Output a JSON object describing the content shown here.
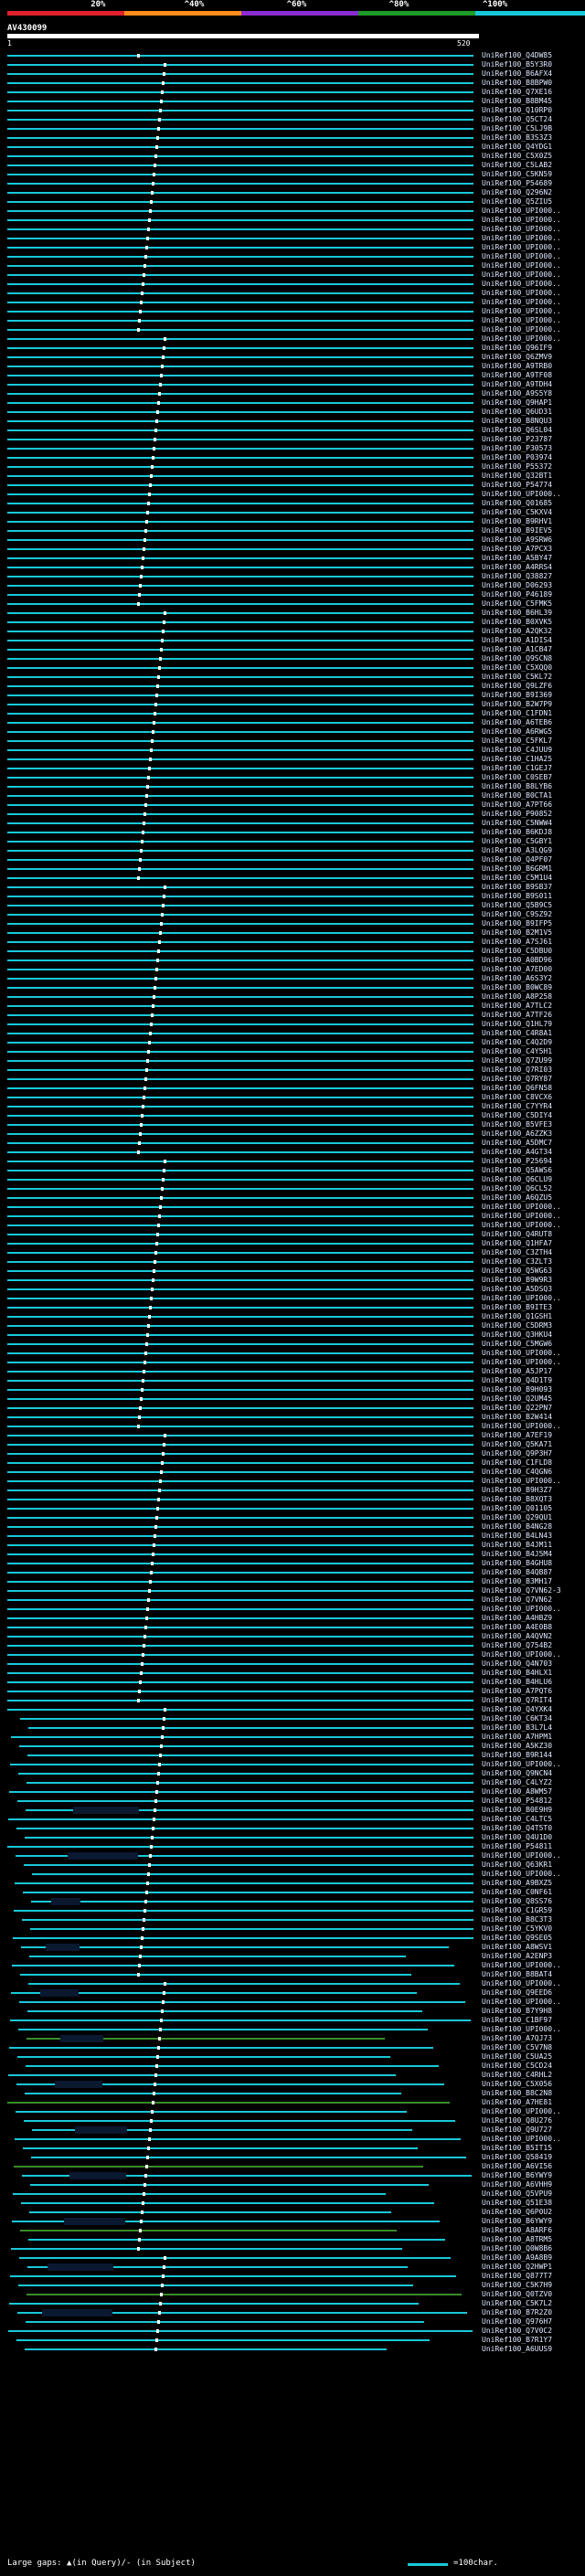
{
  "scale": {
    "labels": [
      "20%",
      "^40%",
      "^60%",
      "^80%",
      "^100%"
    ],
    "colors": [
      "#e0202a",
      "#ff8c1a",
      "#8a2ccf",
      "#1e9c2a",
      "#19c8d8"
    ]
  },
  "query": {
    "id": "AV430099",
    "start": "1",
    "end": "520"
  },
  "line_colors": {
    "default": "#19c8d8",
    "low": "#3a8c2a",
    "gap": "#0a1830"
  },
  "hits": [
    "UniRef100_Q4DW85",
    "UniRef100_B5Y3R0",
    "UniRef100_B6AFX4",
    "UniRef100_B8BPW0",
    "UniRef100_Q7XE16",
    "UniRef100_B8BM45",
    "UniRef100_Q10RP0",
    "UniRef100_Q5CT24",
    "UniRef100_C5LJ9B",
    "UniRef100_B3S3Z3",
    "UniRef100_Q4YDG1",
    "UniRef100_C5X0Z5",
    "UniRef100_C5LAB2",
    "UniRef100_C5KN59",
    "UniRef100_P54689",
    "UniRef100_Q296N2",
    "UniRef100_Q5ZIU5",
    "UniRef100_UPI000..",
    "UniRef100_UPI000..",
    "UniRef100_UPI000..",
    "UniRef100_UPI000..",
    "UniRef100_UPI000..",
    "UniRef100_UPI000..",
    "UniRef100_UPI000..",
    "UniRef100_UPI000..",
    "UniRef100_UPI000..",
    "UniRef100_UPI000..",
    "UniRef100_UPI000..",
    "UniRef100_UPI000..",
    "UniRef100_UPI000..",
    "UniRef100_UPI000..",
    "UniRef100_UPI000..",
    "UniRef100_Q96IF9",
    "UniRef100_Q6ZMV9",
    "UniRef100_A9TRB0",
    "UniRef100_A9TF08",
    "UniRef100_A9TDH4",
    "UniRef100_A9S5Y8",
    "UniRef100_Q9HAP1",
    "UniRef100_Q6UD31",
    "UniRef100_B8NQU3",
    "UniRef100_Q6SL04",
    "UniRef100_P23787",
    "UniRef100_P30573",
    "UniRef100_P03974",
    "UniRef100_P55372",
    "UniRef100_Q32BT1",
    "UniRef100_P54774",
    "UniRef100_UPI000..",
    "UniRef100_Q01685",
    "UniRef100_C5KXV4",
    "UniRef100_B9RHV1",
    "UniRef100_B9IEV5",
    "UniRef100_A9SRW6",
    "UniRef100_A7PCX3",
    "UniRef100_A5BY47",
    "UniRef100_A4RRS4",
    "UniRef100_Q38827",
    "UniRef100_D06293",
    "UniRef100_P46189",
    "UniRef100_C5FMK5",
    "UniRef100_B6HL39",
    "UniRef100_B0XVK5",
    "UniRef100_A2QK32",
    "UniRef100_A1DIS4",
    "UniRef100_A1CB47",
    "UniRef100_Q9SCN8",
    "UniRef100_C5XQQ0",
    "UniRef100_C5KL72",
    "UniRef100_Q9LZF6",
    "UniRef100_B9I369",
    "UniRef100_B2W7P9",
    "UniRef100_C1FDN1",
    "UniRef100_A6TEB6",
    "UniRef100_A6RWG5",
    "UniRef100_C5FKL7",
    "UniRef100_C4JUU9",
    "UniRef100_C1HA25",
    "UniRef100_C1GEJ7",
    "UniRef100_C0SEB7",
    "UniRef100_B8LYB6",
    "UniRef100_B0CTA1",
    "UniRef100_A7PT66",
    "UniRef100_P90852",
    "UniRef100_C5NWW4",
    "UniRef100_B6KDJ8",
    "UniRef100_C5GBY1",
    "UniRef100_A3LQG9",
    "UniRef100_Q4PF07",
    "UniRef100_B6GRM1",
    "UniRef100_C5M1U4",
    "UniRef100_B9SB37",
    "UniRef100_B9S011",
    "UniRef100_Q5B9C5",
    "UniRef100_C9SZ92",
    "UniRef100_B9IFP5",
    "UniRef100_B2M1V5",
    "UniRef100_A7SJ61",
    "UniRef100_C5DBU0",
    "UniRef100_A0BD96",
    "UniRef100_A7ED00",
    "UniRef100_A6S3Y2",
    "UniRef100_B0WC89",
    "UniRef100_A8P258",
    "UniRef100_A7TLC2",
    "UniRef100_A7TF26",
    "UniRef100_Q1HL79",
    "UniRef100_C4R8A1",
    "UniRef100_C4Q2D9",
    "UniRef100_C4Y5H1",
    "UniRef100_Q7ZU99",
    "UniRef100_Q7RI03",
    "UniRef100_Q7RY87",
    "UniRef100_Q6FN58",
    "UniRef100_C8VCX6",
    "UniRef100_C7YYR4",
    "UniRef100_C5DIY4",
    "UniRef100_B5VFE3",
    "UniRef100_A6ZZK3",
    "UniRef100_A5DMC7",
    "UniRef100_A4GT34",
    "UniRef100_P25694",
    "UniRef100_Q5AWS6",
    "UniRef100_Q6CLU9",
    "UniRef100_Q6CL52",
    "UniRef100_A6QZU5",
    "UniRef100_UPI000..",
    "UniRef100_UPI000..",
    "UniRef100_UPI000..",
    "UniRef100_Q4RUT8",
    "UniRef100_Q1HFA7",
    "UniRef100_C3ZTH4",
    "UniRef100_C3ZLT3",
    "UniRef100_Q5WG63",
    "UniRef100_B9W9R3",
    "UniRef100_A5DSQ3",
    "UniRef100_UPI000..",
    "UniRef100_B9ITE3",
    "UniRef100_Q1GSH1",
    "UniRef100_C5DRM3",
    "UniRef100_Q3HKU4",
    "UniRef100_C5MGW6",
    "UniRef100_UPI000..",
    "UniRef100_UPI000..",
    "UniRef100_A5JP17",
    "UniRef100_Q4D1T9",
    "UniRef100_B9H093",
    "UniRef100_Q2UM45",
    "UniRef100_Q22PN7",
    "UniRef100_B2W414",
    "UniRef100_UPI000..",
    "UniRef100_A7EF19",
    "UniRef100_Q5KA71",
    "UniRef100_Q9P3H7",
    "UniRef100_C1FLD8",
    "UniRef100_C4QGN6",
    "UniRef100_UPI000..",
    "UniRef100_B9H3Z7",
    "UniRef100_B8XQT3",
    "UniRef100_Q01105",
    "UniRef100_Q29QU1",
    "UniRef100_B4NG28",
    "UniRef100_B4LN43",
    "UniRef100_B4JM11",
    "UniRef100_B4J5M4",
    "UniRef100_B4GHU8",
    "UniRef100_B4QB87",
    "UniRef100_B3MH17",
    "UniRef100_Q7VN62-3",
    "UniRef100_Q7VN62",
    "UniRef100_UPI000..",
    "UniRef100_A4HBZ9",
    "UniRef100_A4E0B8",
    "UniRef100_A4QVN2",
    "UniRef100_Q754B2",
    "UniRef100_UPI000..",
    "UniRef100_Q4N703",
    "UniRef100_B4HLX1",
    "UniRef100_B4HLU6",
    "UniRef100_A7PQT6",
    "UniRef100_Q7RIT4",
    "UniRef100_Q4YXK4",
    "UniRef100_C6KT34",
    "UniRef100_B3L7L4",
    "UniRef100_A7HPM1",
    "UniRef100_A5KZ30",
    "UniRef100_B9R144",
    "UniRef100_UPI000..",
    "UniRef100_Q9NCN4",
    "UniRef100_C4LYZ2",
    "UniRef100_A8WM57",
    "UniRef100_P54812",
    "UniRef100_B0E9H9",
    "UniRef100_C4LTC5",
    "UniRef100_Q4T5T0",
    "UniRef100_Q4U1D0",
    "UniRef100_P54811",
    "UniRef100_UPI000..",
    "UniRef100_Q63KR1",
    "UniRef100_UPI000..",
    "UniRef100_A9BXZ5",
    "UniRef100_C0NF61",
    "UniRef100_Q8SS76",
    "UniRef100_C1GR59",
    "UniRef100_B8C3T3",
    "UniRef100_C5YKV0",
    "UniRef100_Q9SE05",
    "UniRef100_A8WSV1",
    "UniRef100_A2ENP3",
    "UniRef100_UPI000..",
    "UniRef100_B8BAT4",
    "UniRef100_UPI000..",
    "UniRef100_Q9EED6",
    "UniRef100_UPI000..",
    "UniRef100_B7Y9H8",
    "UniRef100_C1BF97",
    "UniRef100_UPI000..",
    "UniRef100_A7QJ73",
    "UniRef100_C5V7N8",
    "UniRef100_C5UA25",
    "UniRef100_C5CD24",
    "UniRef100_C4RHL2",
    "UniRef100_C5X056",
    "UniRef100_B8C2N8",
    "UniRef100_A7HE81",
    "UniRef100_UPI000..",
    "UniRef100_Q8U276",
    "UniRef100_Q9U727",
    "UniRef100_UPI000..",
    "UniRef100_B5IT15",
    "UniRef100_Q58419",
    "UniRef100_A6VI56",
    "UniRef100_B6YWY9",
    "UniRef100_A6VHH9",
    "UniRef100_Q5VPU9",
    "UniRef100_Q51E38",
    "UniRef100_Q6P0U2",
    "UniRef100_B6YWY9",
    "UniRef100_A8ARF6",
    "UniRef100_A8TRM5",
    "UniRef100_Q0W8B6",
    "UniRef100_A9A8B9",
    "UniRef100_Q2HWP1",
    "UniRef100_Q877T7",
    "UniRef100_C5K7H9",
    "UniRef100_Q0TZV0",
    "UniRef100_C5K7L2",
    "UniRef100_B7R2Z0",
    "UniRef100_Q976H7",
    "UniRef100_Q7V0C2",
    "UniRef100_B7R1Y7",
    "UniRef100_A6UUS9"
  ],
  "legend": {
    "left": "Large gaps: ▲(in Query)/- (in Subject)",
    "right": "=100char."
  }
}
